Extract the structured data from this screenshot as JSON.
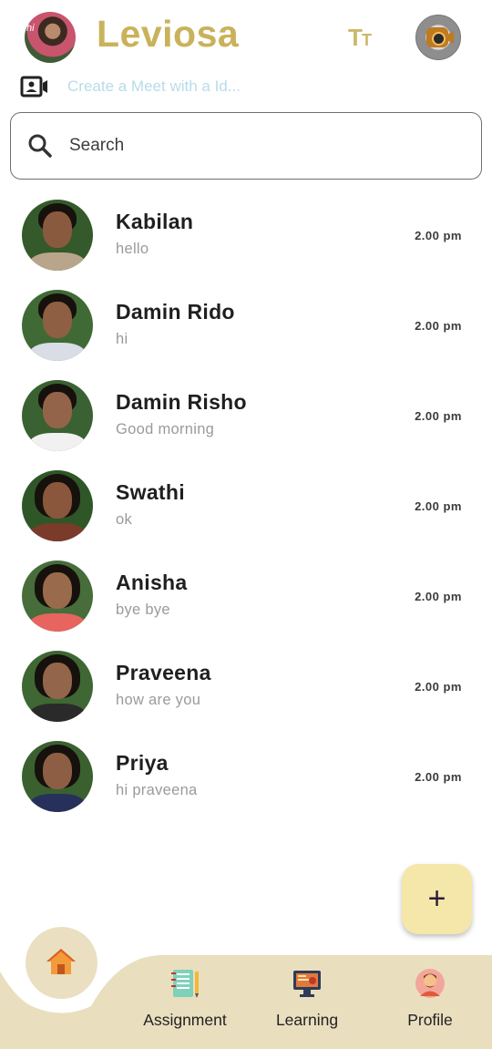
{
  "header": {
    "avatar_tag": "hi",
    "app_title": "Leviosa",
    "text_size_icon": "text-size-icon",
    "webcam_icon": "webcam-icon"
  },
  "meet": {
    "icon": "video-call-icon",
    "placeholder": "Create a Meet with a Id..."
  },
  "search": {
    "icon": "search-icon",
    "placeholder": "Search"
  },
  "chats": [
    {
      "name": "Kabilan",
      "message": "hello",
      "time": "2.00 pm"
    },
    {
      "name": "Damin Rido",
      "message": "hi",
      "time": "2.00 pm"
    },
    {
      "name": "Damin Risho",
      "message": "Good morning",
      "time": "2.00 pm"
    },
    {
      "name": "Swathi",
      "message": "ok",
      "time": "2.00 pm"
    },
    {
      "name": "Anisha",
      "message": "bye bye",
      "time": "2.00 pm"
    },
    {
      "name": "Praveena",
      "message": "how are you",
      "time": "2.00 pm"
    },
    {
      "name": "Priya",
      "message": "hi praveena",
      "time": "2.00 pm"
    }
  ],
  "fab": {
    "label": "+",
    "icon": "plus-icon"
  },
  "nav": {
    "home_icon": "home-icon",
    "assignment": {
      "label": "Assignment",
      "icon": "notebook-icon"
    },
    "learning": {
      "label": "Learning",
      "icon": "monitor-icon"
    },
    "profile": {
      "label": "Profile",
      "icon": "person-icon"
    }
  },
  "colors": {
    "brand_gold": "#c9b25a",
    "fab_bg": "#f5e7a9",
    "nav_bg": "#e9dfbf",
    "placeholder_blue": "#b7dcea"
  }
}
